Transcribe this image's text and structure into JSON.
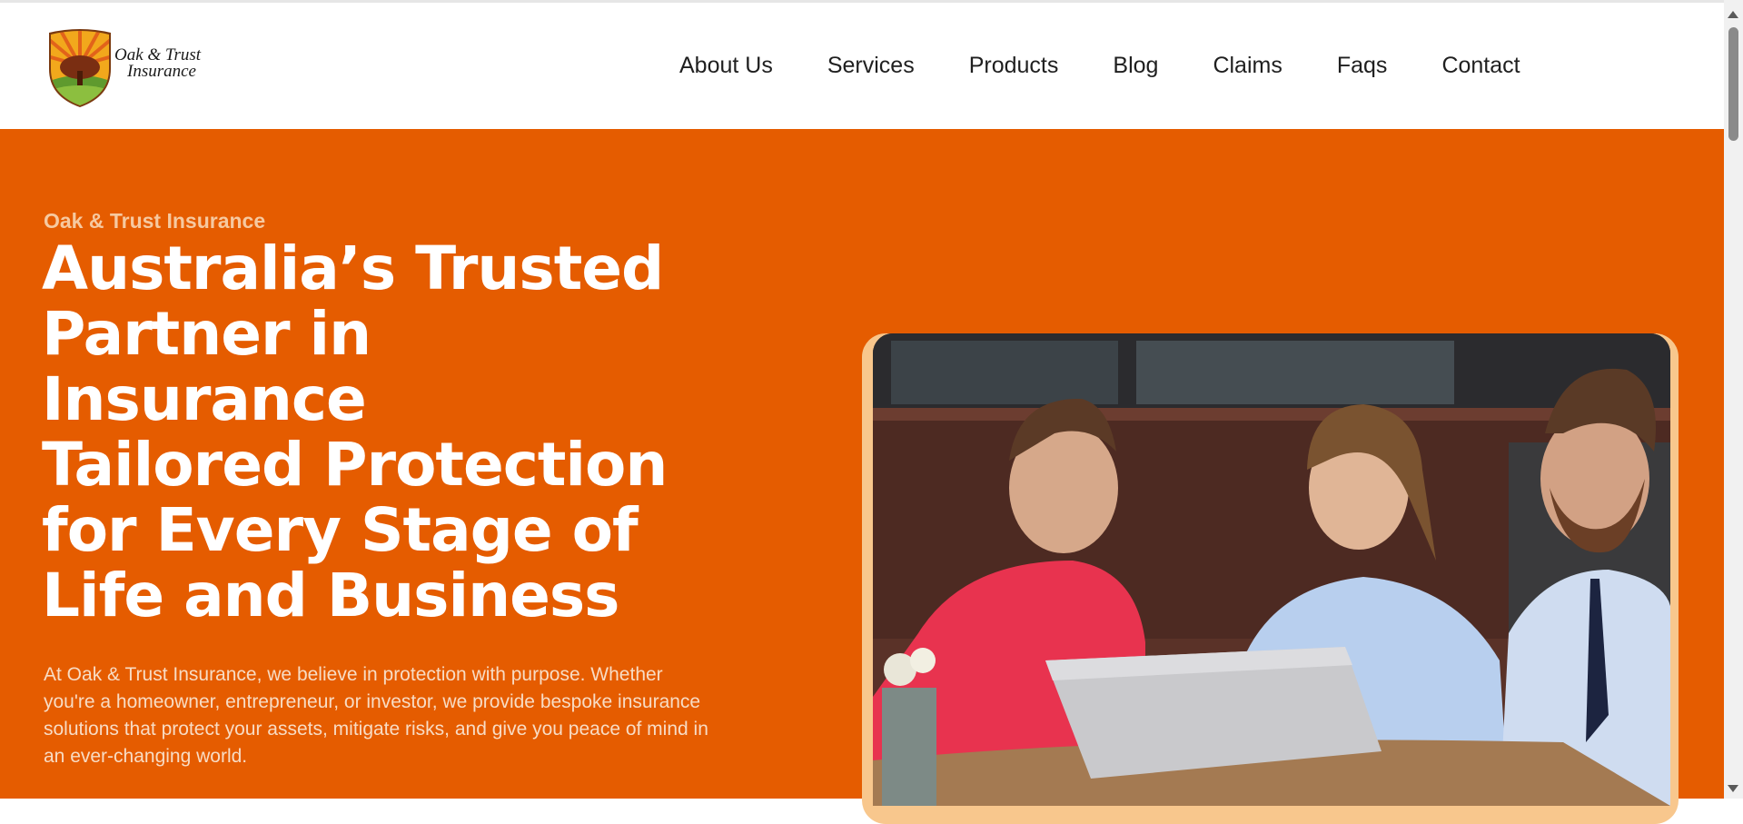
{
  "brand": {
    "name_line1": "Oak & Trust",
    "name_line2": "Insurance",
    "logo_icon": "oak-tree-shield-icon"
  },
  "nav": {
    "items": [
      {
        "label": "About Us"
      },
      {
        "label": "Services"
      },
      {
        "label": "Products"
      },
      {
        "label": "Blog"
      },
      {
        "label": "Claims"
      },
      {
        "label": "Faqs"
      },
      {
        "label": "Contact"
      }
    ]
  },
  "hero": {
    "eyebrow": "Oak & Trust Insurance",
    "headline_lines": [
      "Australia’s Trusted",
      "Partner in",
      "Insurance",
      "Tailored Protection",
      "for Every Stage of",
      "Life and Business"
    ],
    "intro": "At Oak & Trust Insurance, we believe in protection with purpose. Whether you're a homeowner, entrepreneur, or investor, we provide bespoke insurance solutions that protect your assets, mitigate risks, and give you peace of mind in an ever-changing world."
  },
  "colors": {
    "accent": "#e55c00",
    "frame": "#f8c78d",
    "eyebrow": "#f6c9a0"
  }
}
